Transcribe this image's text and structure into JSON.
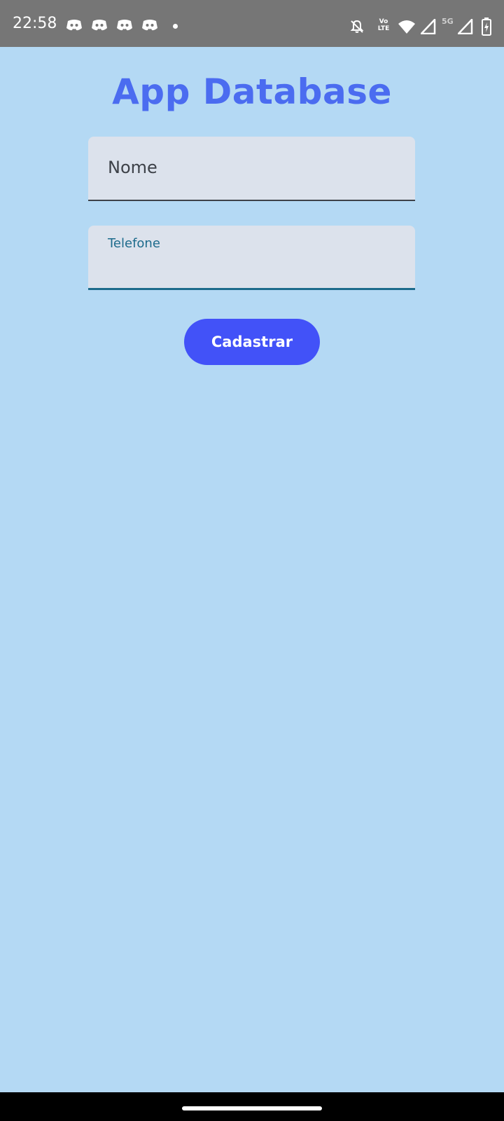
{
  "status_bar": {
    "time": "22:58",
    "notification_icons": [
      "discord-icon",
      "discord-icon",
      "discord-icon",
      "discord-icon"
    ],
    "more_notifications_icon": "dot-icon",
    "system_icons": [
      "bell-off-icon",
      "volte-lte-icon",
      "wifi-icon",
      "cell-signal-icon",
      "cell-signal-5g-icon",
      "battery-charging-icon"
    ],
    "volte_label_top": "Vo",
    "volte_label_bottom": "LTE",
    "network_label": "5G"
  },
  "app": {
    "title": "App Database",
    "title_color": "#4b6cf0",
    "background_color": "#b4d9f4"
  },
  "form": {
    "nome": {
      "placeholder": "Nome",
      "value": ""
    },
    "telefone": {
      "label": "Telefone",
      "value": "",
      "focused": true
    },
    "submit_label": "Cadastrar",
    "submit_color": "#4252f8"
  },
  "nav_bar": {
    "gesture_handle": "home-gesture-handle"
  }
}
